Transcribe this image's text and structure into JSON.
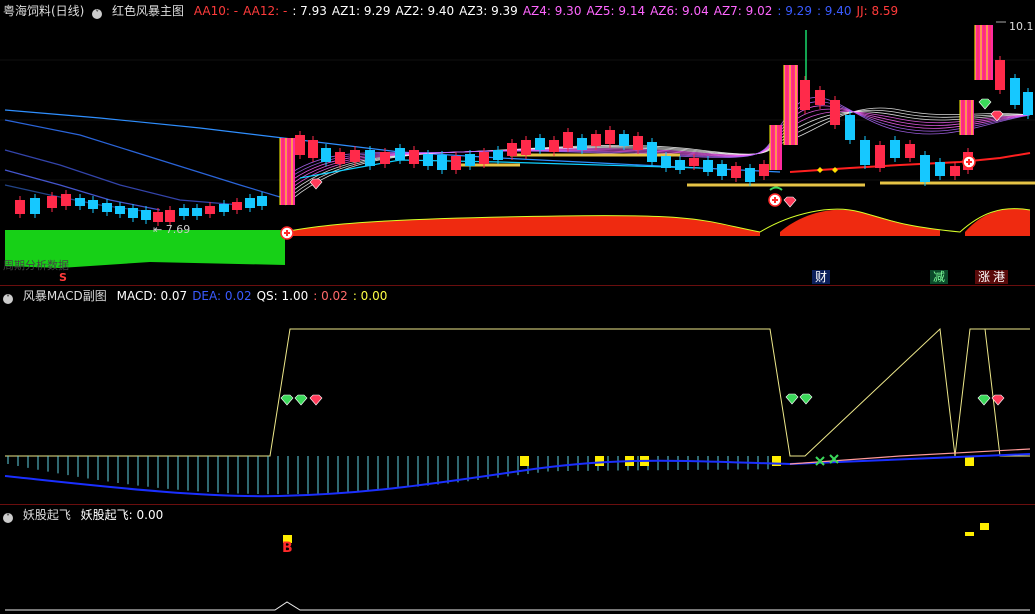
{
  "main": {
    "stock_name": "粤海饲料(日线)",
    "indicator_name": "红色风暴主图",
    "values": [
      {
        "label": "AA10:",
        "value": "-",
        "color": "#ff3b3b"
      },
      {
        "label": "AA12:",
        "value": "-",
        "color": "#ff3b3b"
      },
      {
        "label": ":",
        "value": "7.93",
        "color": "#ffffff"
      },
      {
        "label": "AZ1:",
        "value": "9.29",
        "color": "#ffffff"
      },
      {
        "label": "AZ2:",
        "value": "9.40",
        "color": "#ffffff"
      },
      {
        "label": "AZ3:",
        "value": "9.39",
        "color": "#ffffff"
      },
      {
        "label": "AZ4:",
        "value": "9.30",
        "color": "#ff66ff"
      },
      {
        "label": "AZ5:",
        "value": "9.14",
        "color": "#ff66ff"
      },
      {
        "label": "AZ6:",
        "value": "9.04",
        "color": "#ff66ff"
      },
      {
        "label": "AZ7:",
        "value": "9.02",
        "color": "#ff66ff"
      },
      {
        "label": ":",
        "value": "9.29",
        "color": "#3a5bff"
      },
      {
        "label": ":",
        "value": "9.40",
        "color": "#3a5bff"
      },
      {
        "label": "JJ:",
        "value": "8.59",
        "color": "#ff3b3b"
      }
    ],
    "high_price": "10.1",
    "low_price": "7.69",
    "bottom_left_text": "周期分析数据",
    "marker_s": "S",
    "marker_cai": "财",
    "marker_jian": "减",
    "marker_zhang": "涨",
    "marker_gang": "港"
  },
  "macd": {
    "indicator_name": "风暴MACD副图",
    "values": [
      {
        "label": "MACD:",
        "value": "0.07",
        "color": "#ffffff"
      },
      {
        "label": "DEA:",
        "value": "0.02",
        "color": "#3a5bff"
      },
      {
        "label": "QS:",
        "value": "1.00",
        "color": "#ffffff"
      },
      {
        "label": ":",
        "value": "0.02",
        "color": "#ff6a6a"
      },
      {
        "label": ":",
        "value": "0.00",
        "color": "#ffff44"
      }
    ]
  },
  "yao": {
    "indicator_name": "妖股起飞",
    "values": [
      {
        "label": "妖股起飞:",
        "value": "0.00",
        "color": "#ffffff"
      }
    ],
    "marker_b": "B"
  }
}
